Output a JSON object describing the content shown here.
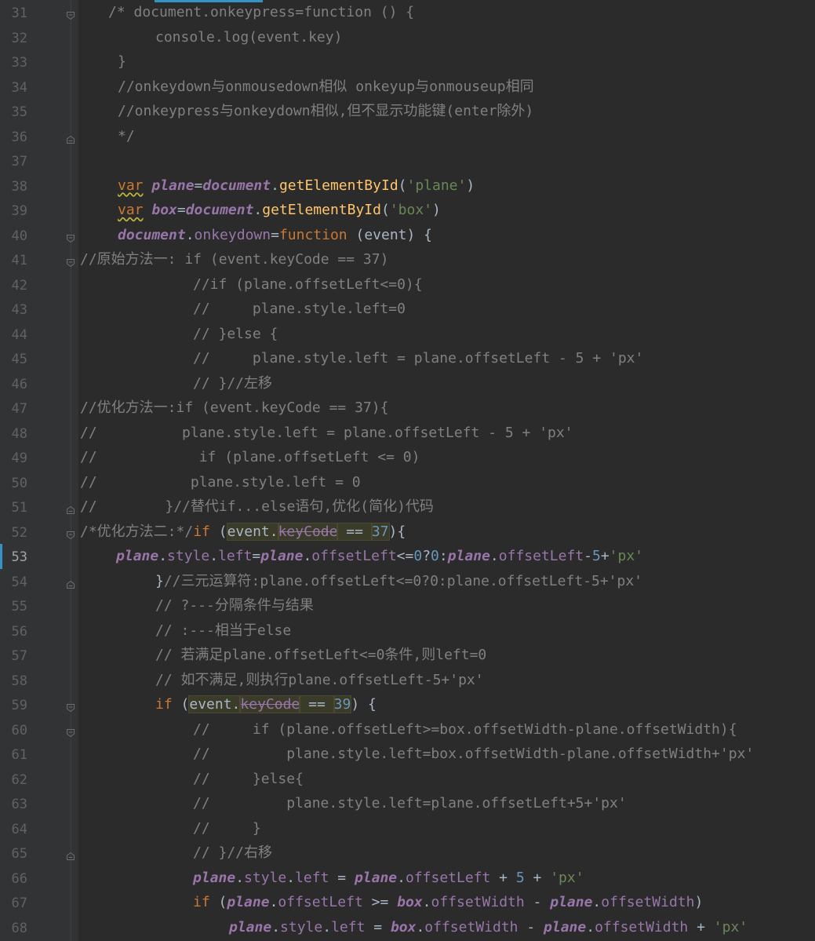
{
  "editor": {
    "gutter": {
      "line_numbers": [
        "31",
        "32",
        "33",
        "34",
        "35",
        "36",
        "37",
        "38",
        "39",
        "40",
        "41",
        "42",
        "43",
        "44",
        "45",
        "46",
        "47",
        "48",
        "49",
        "50",
        "51",
        "52",
        "53",
        "54",
        "55",
        "56",
        "57",
        "58",
        "59",
        "60",
        "61",
        "62",
        "63",
        "64",
        "65",
        "66",
        "67",
        "68"
      ]
    },
    "lines": [
      {
        "n": "31",
        "fold": "open",
        "indent": 36,
        "tokens": [
          {
            "t": "/* document.onkeypress=function () {",
            "c": "cm"
          }
        ]
      },
      {
        "n": "32",
        "fold": "",
        "indent": 96,
        "tokens": [
          {
            "t": "console.log(event.key)",
            "c": "cm"
          }
        ]
      },
      {
        "n": "33",
        "fold": "",
        "indent": 48,
        "tokens": [
          {
            "t": "}",
            "c": "cm"
          }
        ]
      },
      {
        "n": "34",
        "fold": "",
        "indent": 48,
        "tokens": [
          {
            "t": "//onkeydown与onmousedown相似 onkeyup与onmouseup相同",
            "c": "cm"
          }
        ]
      },
      {
        "n": "35",
        "fold": "",
        "indent": 48,
        "tokens": [
          {
            "t": "//onkeypress与onkeydown相似,但不显示功能键(enter除外)",
            "c": "cm"
          }
        ]
      },
      {
        "n": "36",
        "fold": "close",
        "indent": 48,
        "tokens": [
          {
            "t": "*/",
            "c": "cm"
          }
        ]
      },
      {
        "n": "37",
        "fold": "",
        "indent": 0,
        "tokens": []
      },
      {
        "n": "38",
        "fold": "",
        "indent": 48,
        "tokens": [
          {
            "t": "var",
            "c": "kw warn"
          },
          {
            "t": " ",
            "c": "op"
          },
          {
            "t": "plane",
            "c": "gv"
          },
          {
            "t": "=",
            "c": "op"
          },
          {
            "t": "document",
            "c": "gv"
          },
          {
            "t": ".",
            "c": "op"
          },
          {
            "t": "getElementById",
            "c": "fn"
          },
          {
            "t": "(",
            "c": "op"
          },
          {
            "t": "'plane'",
            "c": "str"
          },
          {
            "t": ")",
            "c": "op"
          }
        ]
      },
      {
        "n": "39",
        "fold": "",
        "indent": 48,
        "tokens": [
          {
            "t": "var",
            "c": "kw warn"
          },
          {
            "t": " ",
            "c": "op"
          },
          {
            "t": "box",
            "c": "gv"
          },
          {
            "t": "=",
            "c": "op"
          },
          {
            "t": "document",
            "c": "gv"
          },
          {
            "t": ".",
            "c": "op"
          },
          {
            "t": "getElementById",
            "c": "fn"
          },
          {
            "t": "(",
            "c": "op"
          },
          {
            "t": "'box'",
            "c": "str"
          },
          {
            "t": ")",
            "c": "op"
          }
        ]
      },
      {
        "n": "40",
        "fold": "open",
        "indent": 48,
        "tokens": [
          {
            "t": "document",
            "c": "gv"
          },
          {
            "t": ".",
            "c": "op"
          },
          {
            "t": "onkeydown",
            "c": "prop"
          },
          {
            "t": "=",
            "c": "op"
          },
          {
            "t": "function",
            "c": "kw"
          },
          {
            "t": " (event) {",
            "c": "op"
          }
        ]
      },
      {
        "n": "41",
        "fold": "open",
        "indent": 0,
        "tokens": [
          {
            "t": "//原始方法一: if (event.keyCode == 37)",
            "c": "cm"
          }
        ]
      },
      {
        "n": "42",
        "fold": "",
        "indent": 144,
        "tokens": [
          {
            "t": "//if (plane.offsetLeft<=0){",
            "c": "cm"
          }
        ]
      },
      {
        "n": "43",
        "fold": "",
        "indent": 144,
        "tokens": [
          {
            "t": "//     plane.style.left=0",
            "c": "cm"
          }
        ]
      },
      {
        "n": "44",
        "fold": "",
        "indent": 144,
        "tokens": [
          {
            "t": "// }else {",
            "c": "cm"
          }
        ]
      },
      {
        "n": "45",
        "fold": "",
        "indent": 144,
        "tokens": [
          {
            "t": "//     plane.style.left = plane.offsetLeft - 5 + 'px'",
            "c": "cm"
          }
        ]
      },
      {
        "n": "46",
        "fold": "",
        "indent": 144,
        "tokens": [
          {
            "t": "// }//左移",
            "c": "cm"
          }
        ]
      },
      {
        "n": "47",
        "fold": "",
        "indent": 0,
        "tokens": [
          {
            "t": "//优化方法一:if (event.keyCode == 37){",
            "c": "cm"
          }
        ]
      },
      {
        "n": "48",
        "fold": "",
        "indent": 0,
        "tokens": [
          {
            "t": "//          plane.style.left = plane.offsetLeft - 5 + 'px'",
            "c": "cm"
          }
        ]
      },
      {
        "n": "49",
        "fold": "",
        "indent": 0,
        "tokens": [
          {
            "t": "//            if (plane.offsetLeft <= 0)",
            "c": "cm"
          }
        ]
      },
      {
        "n": "50",
        "fold": "",
        "indent": 0,
        "tokens": [
          {
            "t": "//           plane.style.left = 0",
            "c": "cm"
          }
        ]
      },
      {
        "n": "51",
        "fold": "close",
        "indent": 0,
        "tokens": [
          {
            "t": "//        }//替代if...else语句,优化(简化)代码",
            "c": "cm"
          }
        ]
      },
      {
        "n": "52",
        "fold": "open",
        "indent": 0,
        "tokens": [
          {
            "t": "/*优化方法二:*/",
            "c": "cm"
          },
          {
            "t": "if",
            "c": "kw"
          },
          {
            "t": " (",
            "c": "op"
          },
          {
            "t": "event.",
            "c": "op hl"
          },
          {
            "t": "keyCode",
            "c": "dep hl"
          },
          {
            "t": " == ",
            "c": "op hl"
          },
          {
            "t": "37",
            "c": "num hl"
          },
          {
            "t": "){",
            "c": "op"
          }
        ]
      },
      {
        "n": "53",
        "fold": "",
        "indent": 46,
        "current": true,
        "tokens": [
          {
            "t": "plane",
            "c": "gv"
          },
          {
            "t": ".",
            "c": "op"
          },
          {
            "t": "style",
            "c": "prop"
          },
          {
            "t": ".",
            "c": "op"
          },
          {
            "t": "left",
            "c": "prop"
          },
          {
            "t": "=",
            "c": "op"
          },
          {
            "t": "plane",
            "c": "gv"
          },
          {
            "t": ".",
            "c": "op"
          },
          {
            "t": "offsetLeft",
            "c": "prop"
          },
          {
            "t": "<=",
            "c": "op"
          },
          {
            "t": "0",
            "c": "num"
          },
          {
            "t": "?",
            "c": "op"
          },
          {
            "t": "0",
            "c": "num"
          },
          {
            "t": ":",
            "c": "op"
          },
          {
            "t": "plane",
            "c": "gv"
          },
          {
            "t": ".",
            "c": "op"
          },
          {
            "t": "offsetLeft",
            "c": "prop"
          },
          {
            "t": "-",
            "c": "op"
          },
          {
            "t": "5",
            "c": "num"
          },
          {
            "t": "+",
            "c": "op"
          },
          {
            "t": "'px'",
            "c": "str"
          }
        ]
      },
      {
        "n": "54",
        "fold": "close",
        "indent": 96,
        "tokens": [
          {
            "t": "}",
            "c": "op"
          },
          {
            "t": "//三元运算符:plane.offsetLeft<=0?0:plane.offsetLeft-5+'px'",
            "c": "cm"
          }
        ]
      },
      {
        "n": "55",
        "fold": "",
        "indent": 96,
        "tokens": [
          {
            "t": "// ?---分隔条件与结果",
            "c": "cm"
          }
        ]
      },
      {
        "n": "56",
        "fold": "",
        "indent": 96,
        "tokens": [
          {
            "t": "// :---相当于else",
            "c": "cm"
          }
        ]
      },
      {
        "n": "57",
        "fold": "",
        "indent": 96,
        "tokens": [
          {
            "t": "// 若满足plane.offsetLeft<=0条件,则left=0",
            "c": "cm"
          }
        ]
      },
      {
        "n": "58",
        "fold": "",
        "indent": 96,
        "tokens": [
          {
            "t": "// 如不满足,则执行plane.offsetLeft-5+'px'",
            "c": "cm"
          }
        ]
      },
      {
        "n": "59",
        "fold": "open",
        "indent": 96,
        "tokens": [
          {
            "t": "if",
            "c": "kw"
          },
          {
            "t": " (",
            "c": "op"
          },
          {
            "t": "event.",
            "c": "op hl"
          },
          {
            "t": "keyCode",
            "c": "dep hl"
          },
          {
            "t": " == ",
            "c": "op hl"
          },
          {
            "t": "39",
            "c": "num hl"
          },
          {
            "t": ") {",
            "c": "op"
          }
        ]
      },
      {
        "n": "60",
        "fold": "open",
        "indent": 144,
        "tokens": [
          {
            "t": "//     if (plane.offsetLeft>=box.offsetWidth-plane.offsetWidth){",
            "c": "cm"
          }
        ]
      },
      {
        "n": "61",
        "fold": "",
        "indent": 144,
        "tokens": [
          {
            "t": "//         plane.style.left=box.offsetWidth-plane.offsetWidth+'px'",
            "c": "cm"
          }
        ]
      },
      {
        "n": "62",
        "fold": "",
        "indent": 144,
        "tokens": [
          {
            "t": "//     }else{",
            "c": "cm"
          }
        ]
      },
      {
        "n": "63",
        "fold": "",
        "indent": 144,
        "tokens": [
          {
            "t": "//         plane.style.left=plane.offsetLeft+5+'px'",
            "c": "cm"
          }
        ]
      },
      {
        "n": "64",
        "fold": "",
        "indent": 144,
        "tokens": [
          {
            "t": "//     }",
            "c": "cm"
          }
        ]
      },
      {
        "n": "65",
        "fold": "close",
        "indent": 144,
        "tokens": [
          {
            "t": "// }//右移",
            "c": "cm"
          }
        ]
      },
      {
        "n": "66",
        "fold": "",
        "indent": 144,
        "tokens": [
          {
            "t": "plane",
            "c": "gv"
          },
          {
            "t": ".",
            "c": "op"
          },
          {
            "t": "style",
            "c": "prop"
          },
          {
            "t": ".",
            "c": "op"
          },
          {
            "t": "left",
            "c": "prop"
          },
          {
            "t": " = ",
            "c": "op"
          },
          {
            "t": "plane",
            "c": "gv"
          },
          {
            "t": ".",
            "c": "op"
          },
          {
            "t": "offsetLeft",
            "c": "prop"
          },
          {
            "t": " + ",
            "c": "op"
          },
          {
            "t": "5",
            "c": "num"
          },
          {
            "t": " + ",
            "c": "op"
          },
          {
            "t": "'px'",
            "c": "str"
          }
        ]
      },
      {
        "n": "67",
        "fold": "",
        "indent": 144,
        "tokens": [
          {
            "t": "if",
            "c": "kw"
          },
          {
            "t": " (",
            "c": "op"
          },
          {
            "t": "plane",
            "c": "gv"
          },
          {
            "t": ".",
            "c": "op"
          },
          {
            "t": "offsetLeft",
            "c": "prop"
          },
          {
            "t": " >= ",
            "c": "op"
          },
          {
            "t": "box",
            "c": "gv"
          },
          {
            "t": ".",
            "c": "op"
          },
          {
            "t": "offsetWidth",
            "c": "prop"
          },
          {
            "t": " - ",
            "c": "op"
          },
          {
            "t": "plane",
            "c": "gv"
          },
          {
            "t": ".",
            "c": "op"
          },
          {
            "t": "offsetWidth",
            "c": "prop"
          },
          {
            "t": ")",
            "c": "op"
          }
        ]
      },
      {
        "n": "68",
        "fold": "",
        "indent": 190,
        "tokens": [
          {
            "t": "plane",
            "c": "gv"
          },
          {
            "t": ".",
            "c": "op"
          },
          {
            "t": "style",
            "c": "prop"
          },
          {
            "t": ".",
            "c": "op"
          },
          {
            "t": "left",
            "c": "prop"
          },
          {
            "t": " = ",
            "c": "op"
          },
          {
            "t": "box",
            "c": "gv"
          },
          {
            "t": ".",
            "c": "op"
          },
          {
            "t": "offsetWidth",
            "c": "prop"
          },
          {
            "t": " - ",
            "c": "op"
          },
          {
            "t": "plane",
            "c": "gv"
          },
          {
            "t": ".",
            "c": "op"
          },
          {
            "t": "offsetWidth",
            "c": "prop"
          },
          {
            "t": " + ",
            "c": "op"
          },
          {
            "t": "'px'",
            "c": "str"
          }
        ]
      }
    ],
    "colors": {
      "background": "#2b2b2b",
      "gutter": "#313335",
      "keyword": "#cc7832",
      "comment": "#808080",
      "string": "#6a8759",
      "number": "#6897bb",
      "property": "#9876aa",
      "function": "#ffc66d",
      "text": "#a9b7c6"
    }
  }
}
